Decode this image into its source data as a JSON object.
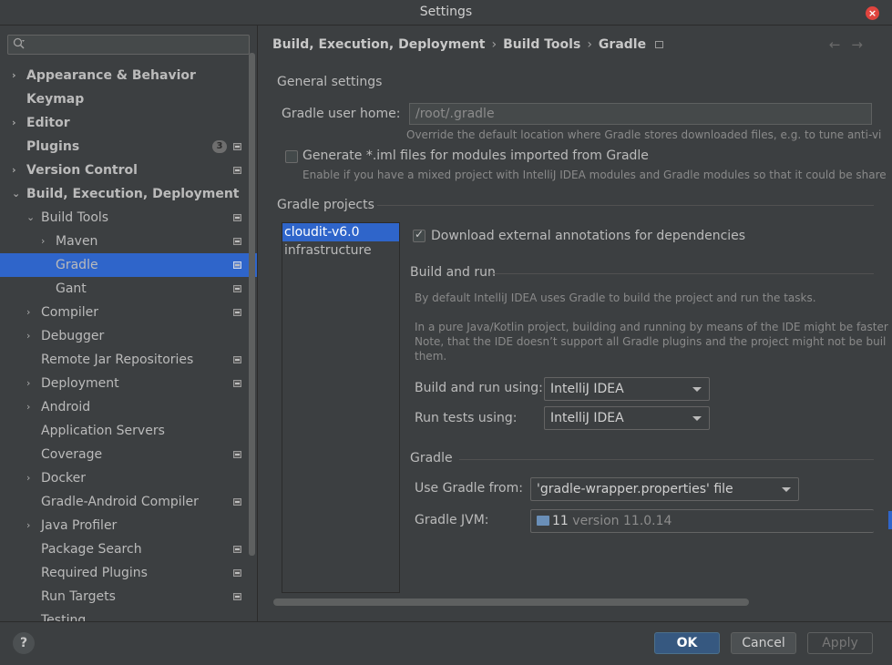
{
  "window": {
    "title": "Settings"
  },
  "search": {
    "placeholder": ""
  },
  "sidebar": {
    "items": [
      {
        "label": "Appearance & Behavior",
        "bold": true,
        "arrow": "›",
        "indent": 0,
        "proj": false
      },
      {
        "label": "Keymap",
        "bold": true,
        "arrow": "",
        "indent": 0,
        "proj": false
      },
      {
        "label": "Editor",
        "bold": true,
        "arrow": "›",
        "indent": 0,
        "proj": false
      },
      {
        "label": "Plugins",
        "bold": true,
        "arrow": "",
        "indent": 0,
        "proj": true,
        "badge": "3"
      },
      {
        "label": "Version Control",
        "bold": true,
        "arrow": "›",
        "indent": 0,
        "proj": true
      },
      {
        "label": "Build, Execution, Deployment",
        "bold": true,
        "arrow": "⌄",
        "indent": 0,
        "proj": false
      },
      {
        "label": "Build Tools",
        "bold": false,
        "arrow": "⌄",
        "indent": 1,
        "proj": true
      },
      {
        "label": "Maven",
        "bold": false,
        "arrow": "›",
        "indent": 2,
        "proj": true
      },
      {
        "label": "Gradle",
        "bold": false,
        "arrow": "",
        "indent": 2,
        "proj": true,
        "selected": true
      },
      {
        "label": "Gant",
        "bold": false,
        "arrow": "",
        "indent": 2,
        "proj": true
      },
      {
        "label": "Compiler",
        "bold": false,
        "arrow": "›",
        "indent": 1,
        "proj": true
      },
      {
        "label": "Debugger",
        "bold": false,
        "arrow": "›",
        "indent": 1,
        "proj": false
      },
      {
        "label": "Remote Jar Repositories",
        "bold": false,
        "arrow": "",
        "indent": 1,
        "proj": true
      },
      {
        "label": "Deployment",
        "bold": false,
        "arrow": "›",
        "indent": 1,
        "proj": true
      },
      {
        "label": "Android",
        "bold": false,
        "arrow": "›",
        "indent": 1,
        "proj": false
      },
      {
        "label": "Application Servers",
        "bold": false,
        "arrow": "",
        "indent": 1,
        "proj": false
      },
      {
        "label": "Coverage",
        "bold": false,
        "arrow": "",
        "indent": 1,
        "proj": true
      },
      {
        "label": "Docker",
        "bold": false,
        "arrow": "›",
        "indent": 1,
        "proj": false
      },
      {
        "label": "Gradle-Android Compiler",
        "bold": false,
        "arrow": "",
        "indent": 1,
        "proj": true
      },
      {
        "label": "Java Profiler",
        "bold": false,
        "arrow": "›",
        "indent": 1,
        "proj": false
      },
      {
        "label": "Package Search",
        "bold": false,
        "arrow": "",
        "indent": 1,
        "proj": true
      },
      {
        "label": "Required Plugins",
        "bold": false,
        "arrow": "",
        "indent": 1,
        "proj": true
      },
      {
        "label": "Run Targets",
        "bold": false,
        "arrow": "",
        "indent": 1,
        "proj": true
      },
      {
        "label": "Testing",
        "bold": false,
        "arrow": "",
        "indent": 1,
        "proj": false
      }
    ]
  },
  "breadcrumb": {
    "part1": "Build, Execution, Deployment",
    "part2": "Build Tools",
    "part3": "Gradle",
    "sep": "›"
  },
  "nav": {
    "back": "←",
    "forward": "→"
  },
  "general": {
    "title": "General settings",
    "user_home_label": "Gradle user home:",
    "user_home_value": "/root/.gradle",
    "user_home_hint": "Override the default location where Gradle stores downloaded files, e.g. to tune anti-vi",
    "iml_label": "Generate *.iml files for modules imported from Gradle",
    "iml_hint": "Enable if you have a mixed project with IntelliJ IDEA modules and Gradle modules so that it could be share"
  },
  "projects": {
    "title": "Gradle projects",
    "items": [
      "cloudit-v6.0",
      "infrastructure"
    ]
  },
  "project_settings": {
    "download_annotations_label": "Download external annotations for dependencies",
    "build_run_title": "Build and run",
    "build_run_hint1": "By default IntelliJ IDEA uses Gradle to build the project and run the tasks.",
    "build_run_hint2": "In a pure Java/Kotlin project, building and running by means of the IDE might be faster",
    "build_run_hint3": "Note, that the IDE doesn’t support all Gradle plugins and the project might not be buil",
    "build_run_hint4": "them.",
    "build_run_using_label": "Build and run using:",
    "build_run_using_value": "IntelliJ IDEA",
    "run_tests_label": "Run tests using:",
    "run_tests_value": "IntelliJ IDEA",
    "gradle_title": "Gradle",
    "use_gradle_from_label": "Use Gradle from:",
    "use_gradle_from_value": "'gradle-wrapper.properties' file",
    "jvm_label": "Gradle JVM:",
    "jvm_version_num": "11",
    "jvm_version_text": "version 11.0.14"
  },
  "footer": {
    "help": "?",
    "ok": "OK",
    "cancel": "Cancel",
    "apply": "Apply"
  }
}
